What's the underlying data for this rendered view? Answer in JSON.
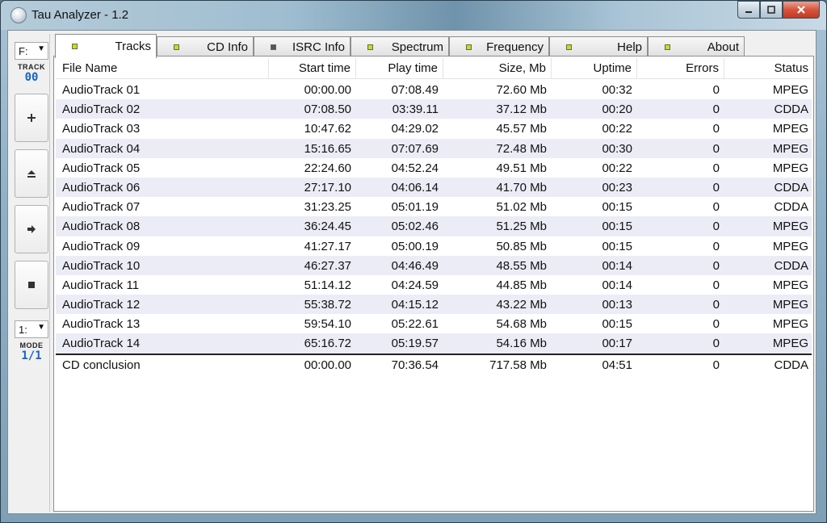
{
  "window": {
    "title": "Tau Analyzer - 1.2"
  },
  "toolbar": {
    "drive": "F:",
    "track_label": "TRACK",
    "track_value": "00",
    "mode_select": "1:",
    "mode_label": "MODE",
    "mode_value": "1/1",
    "buttons": [
      "add",
      "eject",
      "next",
      "stop"
    ]
  },
  "tabs": [
    {
      "label": "Tracks",
      "active": true,
      "led": "yellow"
    },
    {
      "label": "CD Info",
      "active": false,
      "led": "yellow"
    },
    {
      "label": "ISRC Info",
      "active": false,
      "led": "gray"
    },
    {
      "label": "Spectrum",
      "active": false,
      "led": "yellow"
    },
    {
      "label": "Frequency",
      "active": false,
      "led": "yellow"
    },
    {
      "label": "Help",
      "active": false,
      "led": "yellow"
    },
    {
      "label": "About",
      "active": false,
      "led": "yellow"
    }
  ],
  "columns": [
    "File Name",
    "Start time",
    "Play time",
    "Size, Mb",
    "Uptime",
    "Errors",
    "Status"
  ],
  "rows": [
    [
      "AudioTrack 01",
      "00:00.00",
      "07:08.49",
      "72.60 Mb",
      "00:32",
      "0",
      "MPEG"
    ],
    [
      "AudioTrack 02",
      "07:08.50",
      "03:39.11",
      "37.12 Mb",
      "00:20",
      "0",
      "CDDA"
    ],
    [
      "AudioTrack 03",
      "10:47.62",
      "04:29.02",
      "45.57 Mb",
      "00:22",
      "0",
      "MPEG"
    ],
    [
      "AudioTrack 04",
      "15:16.65",
      "07:07.69",
      "72.48 Mb",
      "00:30",
      "0",
      "MPEG"
    ],
    [
      "AudioTrack 05",
      "22:24.60",
      "04:52.24",
      "49.51 Mb",
      "00:22",
      "0",
      "MPEG"
    ],
    [
      "AudioTrack 06",
      "27:17.10",
      "04:06.14",
      "41.70 Mb",
      "00:23",
      "0",
      "CDDA"
    ],
    [
      "AudioTrack 07",
      "31:23.25",
      "05:01.19",
      "51.02 Mb",
      "00:15",
      "0",
      "CDDA"
    ],
    [
      "AudioTrack 08",
      "36:24.45",
      "05:02.46",
      "51.25 Mb",
      "00:15",
      "0",
      "MPEG"
    ],
    [
      "AudioTrack 09",
      "41:27.17",
      "05:00.19",
      "50.85 Mb",
      "00:15",
      "0",
      "MPEG"
    ],
    [
      "AudioTrack 10",
      "46:27.37",
      "04:46.49",
      "48.55 Mb",
      "00:14",
      "0",
      "CDDA"
    ],
    [
      "AudioTrack 11",
      "51:14.12",
      "04:24.59",
      "44.85 Mb",
      "00:14",
      "0",
      "MPEG"
    ],
    [
      "AudioTrack 12",
      "55:38.72",
      "04:15.12",
      "43.22 Mb",
      "00:13",
      "0",
      "MPEG"
    ],
    [
      "AudioTrack 13",
      "59:54.10",
      "05:22.61",
      "54.68 Mb",
      "00:15",
      "0",
      "MPEG"
    ],
    [
      "AudioTrack 14",
      "65:16.72",
      "05:19.57",
      "54.16 Mb",
      "00:17",
      "0",
      "MPEG"
    ]
  ],
  "summary": [
    "CD conclusion",
    "00:00.00",
    "70:36.54",
    "717.58 Mb",
    "04:51",
    "0",
    "CDDA"
  ],
  "colors": {
    "alt_row": "#ececf7",
    "led_yellow": "#c8e000",
    "track_value": "#1464c8",
    "close_button": "#d7543c"
  }
}
